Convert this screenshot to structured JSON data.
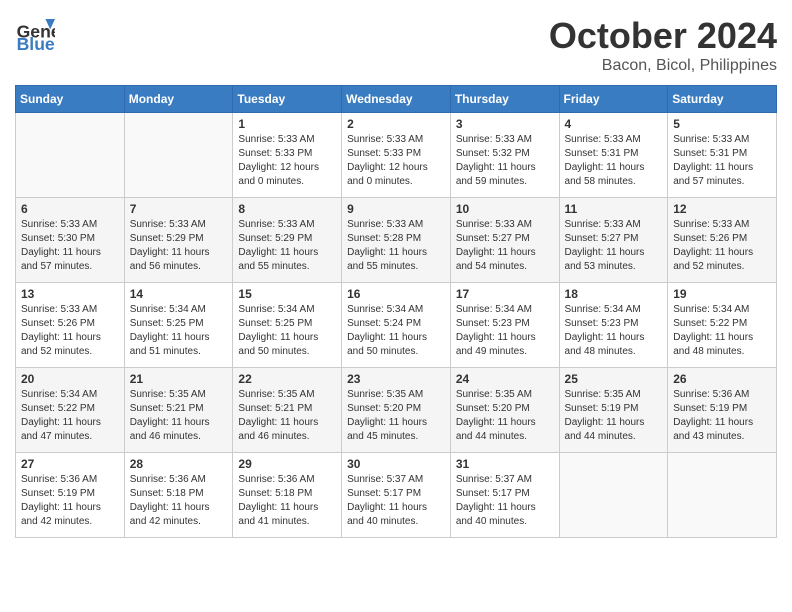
{
  "logo": {
    "line1": "General",
    "line2": "Blue"
  },
  "title": "October 2024",
  "subtitle": "Bacon, Bicol, Philippines",
  "header_days": [
    "Sunday",
    "Monday",
    "Tuesday",
    "Wednesday",
    "Thursday",
    "Friday",
    "Saturday"
  ],
  "weeks": [
    [
      {
        "day": "",
        "sunrise": "",
        "sunset": "",
        "daylight": ""
      },
      {
        "day": "",
        "sunrise": "",
        "sunset": "",
        "daylight": ""
      },
      {
        "day": "1",
        "sunrise": "Sunrise: 5:33 AM",
        "sunset": "Sunset: 5:33 PM",
        "daylight": "Daylight: 12 hours and 0 minutes."
      },
      {
        "day": "2",
        "sunrise": "Sunrise: 5:33 AM",
        "sunset": "Sunset: 5:33 PM",
        "daylight": "Daylight: 12 hours and 0 minutes."
      },
      {
        "day": "3",
        "sunrise": "Sunrise: 5:33 AM",
        "sunset": "Sunset: 5:32 PM",
        "daylight": "Daylight: 11 hours and 59 minutes."
      },
      {
        "day": "4",
        "sunrise": "Sunrise: 5:33 AM",
        "sunset": "Sunset: 5:31 PM",
        "daylight": "Daylight: 11 hours and 58 minutes."
      },
      {
        "day": "5",
        "sunrise": "Sunrise: 5:33 AM",
        "sunset": "Sunset: 5:31 PM",
        "daylight": "Daylight: 11 hours and 57 minutes."
      }
    ],
    [
      {
        "day": "6",
        "sunrise": "Sunrise: 5:33 AM",
        "sunset": "Sunset: 5:30 PM",
        "daylight": "Daylight: 11 hours and 57 minutes."
      },
      {
        "day": "7",
        "sunrise": "Sunrise: 5:33 AM",
        "sunset": "Sunset: 5:29 PM",
        "daylight": "Daylight: 11 hours and 56 minutes."
      },
      {
        "day": "8",
        "sunrise": "Sunrise: 5:33 AM",
        "sunset": "Sunset: 5:29 PM",
        "daylight": "Daylight: 11 hours and 55 minutes."
      },
      {
        "day": "9",
        "sunrise": "Sunrise: 5:33 AM",
        "sunset": "Sunset: 5:28 PM",
        "daylight": "Daylight: 11 hours and 55 minutes."
      },
      {
        "day": "10",
        "sunrise": "Sunrise: 5:33 AM",
        "sunset": "Sunset: 5:27 PM",
        "daylight": "Daylight: 11 hours and 54 minutes."
      },
      {
        "day": "11",
        "sunrise": "Sunrise: 5:33 AM",
        "sunset": "Sunset: 5:27 PM",
        "daylight": "Daylight: 11 hours and 53 minutes."
      },
      {
        "day": "12",
        "sunrise": "Sunrise: 5:33 AM",
        "sunset": "Sunset: 5:26 PM",
        "daylight": "Daylight: 11 hours and 52 minutes."
      }
    ],
    [
      {
        "day": "13",
        "sunrise": "Sunrise: 5:33 AM",
        "sunset": "Sunset: 5:26 PM",
        "daylight": "Daylight: 11 hours and 52 minutes."
      },
      {
        "day": "14",
        "sunrise": "Sunrise: 5:34 AM",
        "sunset": "Sunset: 5:25 PM",
        "daylight": "Daylight: 11 hours and 51 minutes."
      },
      {
        "day": "15",
        "sunrise": "Sunrise: 5:34 AM",
        "sunset": "Sunset: 5:25 PM",
        "daylight": "Daylight: 11 hours and 50 minutes."
      },
      {
        "day": "16",
        "sunrise": "Sunrise: 5:34 AM",
        "sunset": "Sunset: 5:24 PM",
        "daylight": "Daylight: 11 hours and 50 minutes."
      },
      {
        "day": "17",
        "sunrise": "Sunrise: 5:34 AM",
        "sunset": "Sunset: 5:23 PM",
        "daylight": "Daylight: 11 hours and 49 minutes."
      },
      {
        "day": "18",
        "sunrise": "Sunrise: 5:34 AM",
        "sunset": "Sunset: 5:23 PM",
        "daylight": "Daylight: 11 hours and 48 minutes."
      },
      {
        "day": "19",
        "sunrise": "Sunrise: 5:34 AM",
        "sunset": "Sunset: 5:22 PM",
        "daylight": "Daylight: 11 hours and 48 minutes."
      }
    ],
    [
      {
        "day": "20",
        "sunrise": "Sunrise: 5:34 AM",
        "sunset": "Sunset: 5:22 PM",
        "daylight": "Daylight: 11 hours and 47 minutes."
      },
      {
        "day": "21",
        "sunrise": "Sunrise: 5:35 AM",
        "sunset": "Sunset: 5:21 PM",
        "daylight": "Daylight: 11 hours and 46 minutes."
      },
      {
        "day": "22",
        "sunrise": "Sunrise: 5:35 AM",
        "sunset": "Sunset: 5:21 PM",
        "daylight": "Daylight: 11 hours and 46 minutes."
      },
      {
        "day": "23",
        "sunrise": "Sunrise: 5:35 AM",
        "sunset": "Sunset: 5:20 PM",
        "daylight": "Daylight: 11 hours and 45 minutes."
      },
      {
        "day": "24",
        "sunrise": "Sunrise: 5:35 AM",
        "sunset": "Sunset: 5:20 PM",
        "daylight": "Daylight: 11 hours and 44 minutes."
      },
      {
        "day": "25",
        "sunrise": "Sunrise: 5:35 AM",
        "sunset": "Sunset: 5:19 PM",
        "daylight": "Daylight: 11 hours and 44 minutes."
      },
      {
        "day": "26",
        "sunrise": "Sunrise: 5:36 AM",
        "sunset": "Sunset: 5:19 PM",
        "daylight": "Daylight: 11 hours and 43 minutes."
      }
    ],
    [
      {
        "day": "27",
        "sunrise": "Sunrise: 5:36 AM",
        "sunset": "Sunset: 5:19 PM",
        "daylight": "Daylight: 11 hours and 42 minutes."
      },
      {
        "day": "28",
        "sunrise": "Sunrise: 5:36 AM",
        "sunset": "Sunset: 5:18 PM",
        "daylight": "Daylight: 11 hours and 42 minutes."
      },
      {
        "day": "29",
        "sunrise": "Sunrise: 5:36 AM",
        "sunset": "Sunset: 5:18 PM",
        "daylight": "Daylight: 11 hours and 41 minutes."
      },
      {
        "day": "30",
        "sunrise": "Sunrise: 5:37 AM",
        "sunset": "Sunset: 5:17 PM",
        "daylight": "Daylight: 11 hours and 40 minutes."
      },
      {
        "day": "31",
        "sunrise": "Sunrise: 5:37 AM",
        "sunset": "Sunset: 5:17 PM",
        "daylight": "Daylight: 11 hours and 40 minutes."
      },
      {
        "day": "",
        "sunrise": "",
        "sunset": "",
        "daylight": ""
      },
      {
        "day": "",
        "sunrise": "",
        "sunset": "",
        "daylight": ""
      }
    ]
  ]
}
